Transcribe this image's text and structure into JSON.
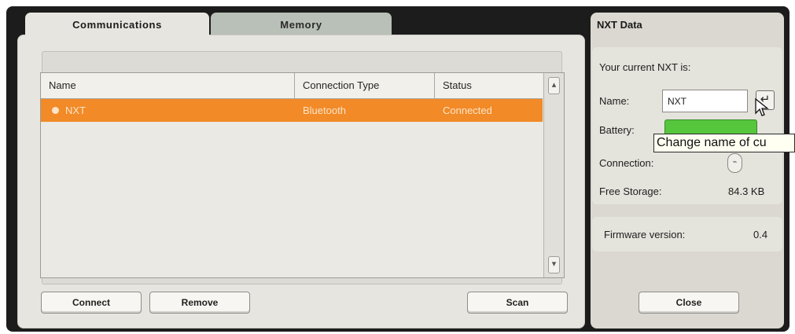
{
  "tabs": [
    {
      "label": "Communications",
      "selected": true
    },
    {
      "label": "Memory",
      "selected": false
    }
  ],
  "list": {
    "columns": [
      "Name",
      "Connection Type",
      "Status"
    ],
    "rows": [
      {
        "name": "NXT",
        "connection_type": "Bluetooth",
        "status": "Connected",
        "selected": true
      }
    ]
  },
  "buttons": {
    "connect": "Connect",
    "remove": "Remove",
    "scan": "Scan",
    "close": "Close"
  },
  "nxt_data": {
    "title": "NXT Data",
    "current_label": "Your current NXT is:",
    "name_label": "Name:",
    "name_value": "NXT",
    "battery_label": "Battery:",
    "connection_label": "Connection:",
    "free_storage_label": "Free Storage:",
    "free_storage_value": "84.3 KB",
    "firmware_label": "Firmware version:",
    "firmware_value": "0.4"
  },
  "tooltip": "Change name of cu",
  "colors": {
    "selection": "#f18a27",
    "battery": "#56c63c",
    "frame": "#1c1c1c"
  },
  "icons": [
    "enter-icon",
    "usb-connection-icon",
    "scroll-up-icon",
    "scroll-down-icon",
    "mouse-cursor-icon"
  ]
}
